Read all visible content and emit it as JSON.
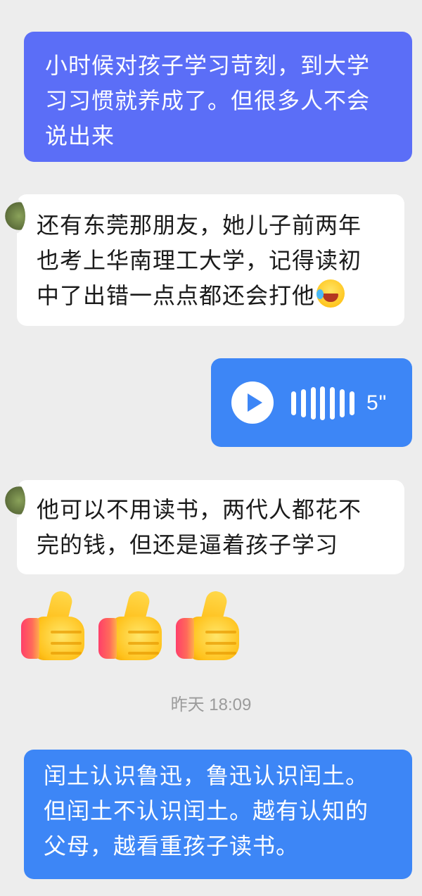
{
  "messages": [
    {
      "lines": [
        "小时候对孩子学习苛刻，到大学",
        "习习惯就养成了。但很多人不会",
        "说出来"
      ]
    },
    {
      "lines": [
        "还有东莞那朋友，她儿子前两年",
        "也考上华南理工大学，记得读初",
        "中了出错一点点都还会打他"
      ]
    },
    {
      "duration": "5\""
    },
    {
      "lines": [
        "他可以不用读书，两代人都花不",
        "完的钱，但还是逼着孩子学习"
      ]
    },
    {
      "lines": [
        "闰土认识鲁迅，鲁迅认识闰土。",
        "但闰土不认识闰土。越有认知的",
        "父母，越看重孩子读书。"
      ]
    }
  ],
  "timestamp": "昨天 18:09",
  "emoji": {
    "laugh_icon": "rolling-on-floor-laughing-icon",
    "thumbs_up_icon": "thumbs-up-icon",
    "thumbs_up_count": 3
  },
  "colors": {
    "background": "#ededed",
    "sent_purple": "#5b6ef7",
    "sent_blue": "#3d86f6",
    "received": "#ffffff"
  }
}
